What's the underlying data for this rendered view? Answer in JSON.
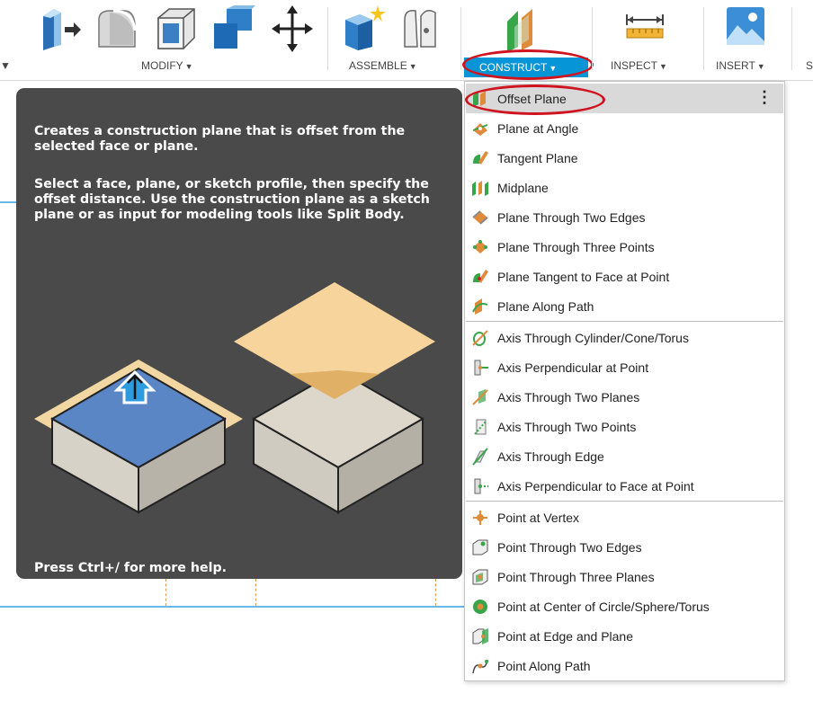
{
  "toolbar": {
    "groups": [
      {
        "label": "MODIFY",
        "caret": "▼"
      },
      {
        "label": "ASSEMBLE",
        "caret": "▼"
      },
      {
        "label": "CONSTRUCT",
        "caret": "▼"
      },
      {
        "label": "INSPECT",
        "caret": "▼"
      },
      {
        "label": "INSERT",
        "caret": "▼"
      }
    ],
    "left_caret": "▼",
    "right_edge_letter": "S",
    "active_group": "CONSTRUCT",
    "accent_color": "#0696d7",
    "annotation_color": "#d0141f"
  },
  "tooltip": {
    "paragraph_1": "Creates a construction plane that is offset from the selected face or plane.",
    "paragraph_2": "Select a face, plane, or sketch profile, then specify the offset distance. Use the construction plane as a sketch plane or as input for modeling tools like Split Body.",
    "footer": "Press Ctrl+/ for more help."
  },
  "menu": {
    "more_options_glyph": "⋮",
    "planes": [
      {
        "label": "Offset Plane",
        "icon": "offset-plane-icon"
      },
      {
        "label": "Plane at Angle",
        "icon": "plane-at-angle-icon"
      },
      {
        "label": "Tangent Plane",
        "icon": "tangent-plane-icon"
      },
      {
        "label": "Midplane",
        "icon": "midplane-icon"
      },
      {
        "label": "Plane Through Two Edges",
        "icon": "plane-two-edges-icon"
      },
      {
        "label": "Plane Through Three Points",
        "icon": "plane-three-points-icon"
      },
      {
        "label": "Plane Tangent to Face at Point",
        "icon": "plane-tangent-face-point-icon"
      },
      {
        "label": "Plane Along Path",
        "icon": "plane-along-path-icon"
      }
    ],
    "axes": [
      {
        "label": "Axis Through Cylinder/Cone/Torus",
        "icon": "axis-cylinder-icon"
      },
      {
        "label": "Axis Perpendicular at Point",
        "icon": "axis-perpendicular-point-icon"
      },
      {
        "label": "Axis Through Two Planes",
        "icon": "axis-two-planes-icon"
      },
      {
        "label": "Axis Through Two Points",
        "icon": "axis-two-points-icon"
      },
      {
        "label": "Axis Through Edge",
        "icon": "axis-edge-icon"
      },
      {
        "label": "Axis Perpendicular to Face at Point",
        "icon": "axis-perpendicular-face-icon"
      }
    ],
    "points": [
      {
        "label": "Point at Vertex",
        "icon": "point-vertex-icon"
      },
      {
        "label": "Point Through Two Edges",
        "icon": "point-two-edges-icon"
      },
      {
        "label": "Point Through Three Planes",
        "icon": "point-three-planes-icon"
      },
      {
        "label": "Point at Center of Circle/Sphere/Torus",
        "icon": "point-center-circle-icon"
      },
      {
        "label": "Point at Edge and Plane",
        "icon": "point-edge-plane-icon"
      },
      {
        "label": "Point Along Path",
        "icon": "point-along-path-icon"
      }
    ]
  }
}
